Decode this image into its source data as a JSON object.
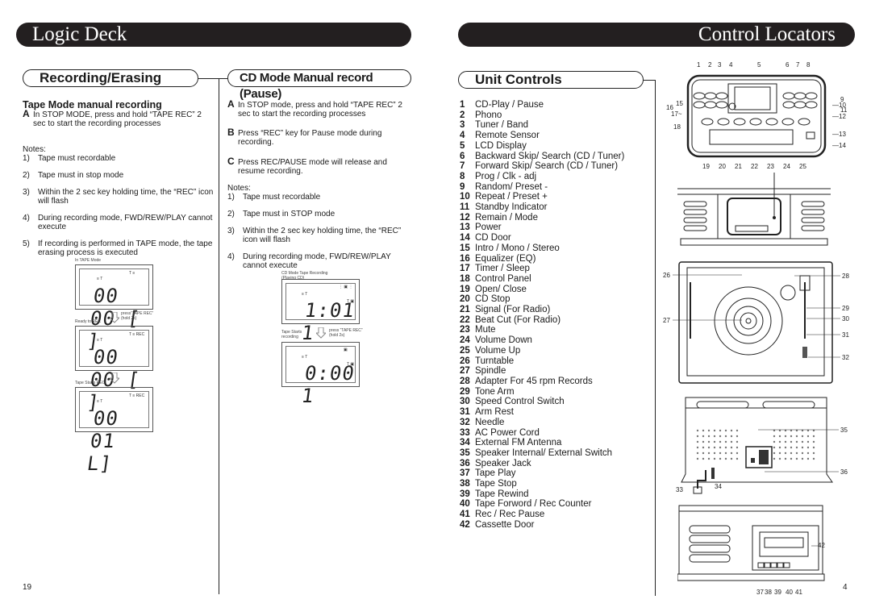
{
  "left_page": {
    "banner_title": "Logic Deck",
    "section_pill": "Recording/Erasing",
    "tape_mode": {
      "title": "Tape Mode manual recording",
      "steps": [
        {
          "letter": "A",
          "text": "In STOP MODE, press and hold “TAPE REC” 2 sec to start the recording processes"
        }
      ],
      "notes_label": "Notes:",
      "notes": [
        {
          "num": "1)",
          "text": "Tape must recordable"
        },
        {
          "num": "2)",
          "text": "Tape must in stop mode"
        },
        {
          "num": "3)",
          "text": "Within the 2 sec key holding time, the “REC” icon will flash"
        },
        {
          "num": "4)",
          "text": "During recording mode, FWD/REW/PLAY cannot execute"
        },
        {
          "num": "5)",
          "text": "If recording is performed in TAPE mode, the tape erasing process is executed"
        }
      ],
      "figure": {
        "caption_1": "In TAPE Mode",
        "lcd_1": "00 00 [ ]",
        "press_label": "press“TAPE REC” (hold 2s)",
        "caption_2": "Ready to REC",
        "lcd_2": "00 00 [ ]",
        "caption_3": "Tape Starts REC",
        "lcd_3": "00 01  L]"
      }
    },
    "cd_mode": {
      "pill": "CD Mode Manual record (Pause)",
      "steps": [
        {
          "letter": "A",
          "text": "In STOP mode, press and hold “TAPE REC” 2 sec to start the recording processes"
        },
        {
          "letter": "B",
          "text": "Press “REC” key for Pause mode during recording."
        },
        {
          "letter": "C",
          "text": "Press REC/PAUSE mode will release and resume recording."
        }
      ],
      "notes_label": "Notes:",
      "notes": [
        {
          "num": "1)",
          "text": "Tape must recordable"
        },
        {
          "num": "2)",
          "text": "Tape must in STOP mode"
        },
        {
          "num": "3)",
          "text": "Within the 2 sec key holding time, the “REC” icon will flash"
        },
        {
          "num": "4)",
          "text": "During recording mode, FWD/REW/PLAY cannot execute"
        }
      ],
      "figure": {
        "caption_1": "CD Mode Tape Recording (Playing CD)",
        "lcd_1": "1:01  1",
        "caption_2": "Tape Starts recording",
        "press_label": "press “TAPE REC” (hold 2s)",
        "lcd_2": "0:00  1"
      }
    },
    "page_number": "19"
  },
  "right_page": {
    "banner_title": "Control Locators",
    "section_pill": "Unit Controls",
    "controls": [
      {
        "num": "1",
        "label": "CD-Play / Pause"
      },
      {
        "num": "2",
        "label": "Phono"
      },
      {
        "num": "3",
        "label": "Tuner / Band"
      },
      {
        "num": "4",
        "label": "Remote Sensor"
      },
      {
        "num": "5",
        "label": "LCD Display"
      },
      {
        "num": "6",
        "label": "Backward Skip/ Search (CD / Tuner)"
      },
      {
        "num": "7",
        "label": "Forward Skip/ Search (CD / Tuner)"
      },
      {
        "num": "8",
        "label": "Prog / Clk - adj"
      },
      {
        "num": "9",
        "label": "Random/ Preset -"
      },
      {
        "num": "10",
        "label": "Repeat / Preset +"
      },
      {
        "num": "11",
        "label": "Standby Indicator"
      },
      {
        "num": "12",
        "label": "Remain / Mode"
      },
      {
        "num": "13",
        "label": "Power"
      },
      {
        "num": "14",
        "label": "CD Door"
      },
      {
        "num": "15",
        "label": "Intro / Mono / Stereo"
      },
      {
        "num": "16",
        "label": "Equalizer (EQ)"
      },
      {
        "num": "17",
        "label": "Timer / Sleep"
      },
      {
        "num": "18",
        "label": "Control Panel"
      },
      {
        "num": "19",
        "label": "Open/ Close"
      },
      {
        "num": "20",
        "label": "CD Stop"
      },
      {
        "num": "21",
        "label": "Signal (For Radio)"
      },
      {
        "num": "22",
        "label": "Beat Cut (For Radio)"
      },
      {
        "num": "23",
        "label": "Mute"
      },
      {
        "num": "24",
        "label": "Volume Down"
      },
      {
        "num": "25",
        "label": "Volume Up"
      },
      {
        "num": "26",
        "label": "Turntable"
      },
      {
        "num": "27",
        "label": "Spindle"
      },
      {
        "num": "28",
        "label": "Adapter For 45 rpm Records"
      },
      {
        "num": "29",
        "label": "Tone Arm"
      },
      {
        "num": "30",
        "label": "Speed Control Switch"
      },
      {
        "num": "31",
        "label": "Arm Rest"
      },
      {
        "num": "32",
        "label": "Needle"
      },
      {
        "num": "33",
        "label": "AC Power Cord"
      },
      {
        "num": "34",
        "label": "External FM Antenna"
      },
      {
        "num": "35",
        "label": "Speaker Internal/ External Switch"
      },
      {
        "num": "36",
        "label": "Speaker Jack"
      },
      {
        "num": "37",
        "label": "Tape Play"
      },
      {
        "num": "38",
        "label": "Tape Stop"
      },
      {
        "num": "39",
        "label": "Tape Rewind"
      },
      {
        "num": "40",
        "label": "Tape Forword / Rec Counter"
      },
      {
        "num": "41",
        "label": "Rec / Rec Pause"
      },
      {
        "num": "42",
        "label": "Cassette Door"
      }
    ],
    "diagram_callouts": {
      "panel_top": [
        "1",
        "2",
        "3",
        "4",
        "5",
        "6",
        "7",
        "8"
      ],
      "panel_left": [
        "15",
        "16",
        "17",
        "18"
      ],
      "panel_right": [
        "9",
        "10",
        "11",
        "12",
        "13",
        "14"
      ],
      "panel_bottom": [
        "19",
        "20",
        "21",
        "22",
        "23",
        "24",
        "25"
      ],
      "turntable": [
        "26",
        "27",
        "28",
        "29",
        "30",
        "31",
        "32"
      ],
      "rear": [
        "33",
        "34",
        "35",
        "36"
      ],
      "side": [
        "37",
        "38",
        "39",
        "40",
        "41",
        "42"
      ]
    },
    "page_number": "4"
  }
}
